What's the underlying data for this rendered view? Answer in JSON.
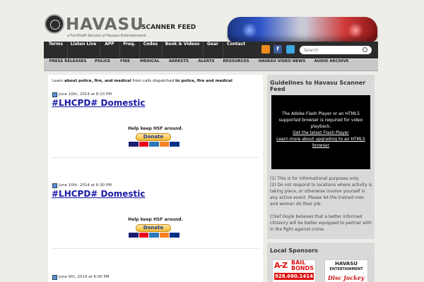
{
  "header": {
    "logo_word": "HAVASU",
    "logo_tagline": "a For-Profit Service of Havasu Entertainment",
    "scanner_feed": "SCANNER FEED"
  },
  "topnav": {
    "items": [
      "Terms",
      "Listen Live",
      "APP",
      "Freq.",
      "Codes",
      "Book & Videos",
      "Gear",
      "Contact"
    ],
    "search_placeholder": "Search",
    "facebook_glyph": "f"
  },
  "subnav": {
    "items": [
      "PRESS RELEASES",
      "POLICE",
      "FIRE",
      "MEDICAL",
      "ARRESTS",
      "ALERTS",
      "RESOURCES",
      "HAVASU VIDEO NEWS",
      "AUDIO ARCHIVE"
    ]
  },
  "main": {
    "intro": {
      "p1": "Learn ",
      "b1": "about police, fire, and medical",
      "p2": " from calls dispatched ",
      "b2": "to police, fire and medical"
    },
    "posts": [
      {
        "date": "June 10th, 2014 at 8:10 PM",
        "title": "#LHCPD# Domestic",
        "help": "Help keep HSF around.",
        "donate": "Donate"
      },
      {
        "date": "June 10th, 2014 at 6:30 PM",
        "title": "#LHCPD# Domestic",
        "help": "Help keep HSF around.",
        "donate": "Donate"
      },
      {
        "date": "June 9th, 2014 at 6:00 PM"
      }
    ]
  },
  "sidebar": {
    "guidelines_title": "Guidelines to Havasu Scanner Feed",
    "video_msg": "The Adobe Flash Player or an HTML5 supported browser is required for video playback.",
    "video_link1": "Get the latest Flash Player",
    "video_link2": "Learn more about upgrading to an HTML5 browser",
    "rule1": "(1) This is for informational purposes only.",
    "rule2": "(2) Do not respond to locations where activity is taking place, or otherwise involve yourself in any active event. Please let the trained men and women do their job.",
    "rule3": "Chief Doyle believes that a better informed citizenry will be better equipped to partner with in the fight against crime.",
    "sponsors_title": "Local Sponsors",
    "sponsor1_a": "A-Z",
    "sponsor1_b1": "BAIL",
    "sponsor1_b2": "BONDS",
    "sponsor1_phone": "928.680.1414",
    "sponsor2_name": "HAVASU",
    "sponsor2_sub": "ENTERTAINMENT",
    "sponsor2_c": "Disc Jockey"
  },
  "colors": {
    "nav_bg": "#2b2b2b",
    "link_blue": "#1a1aa6",
    "subnav_bg": "#c8c8c8"
  }
}
